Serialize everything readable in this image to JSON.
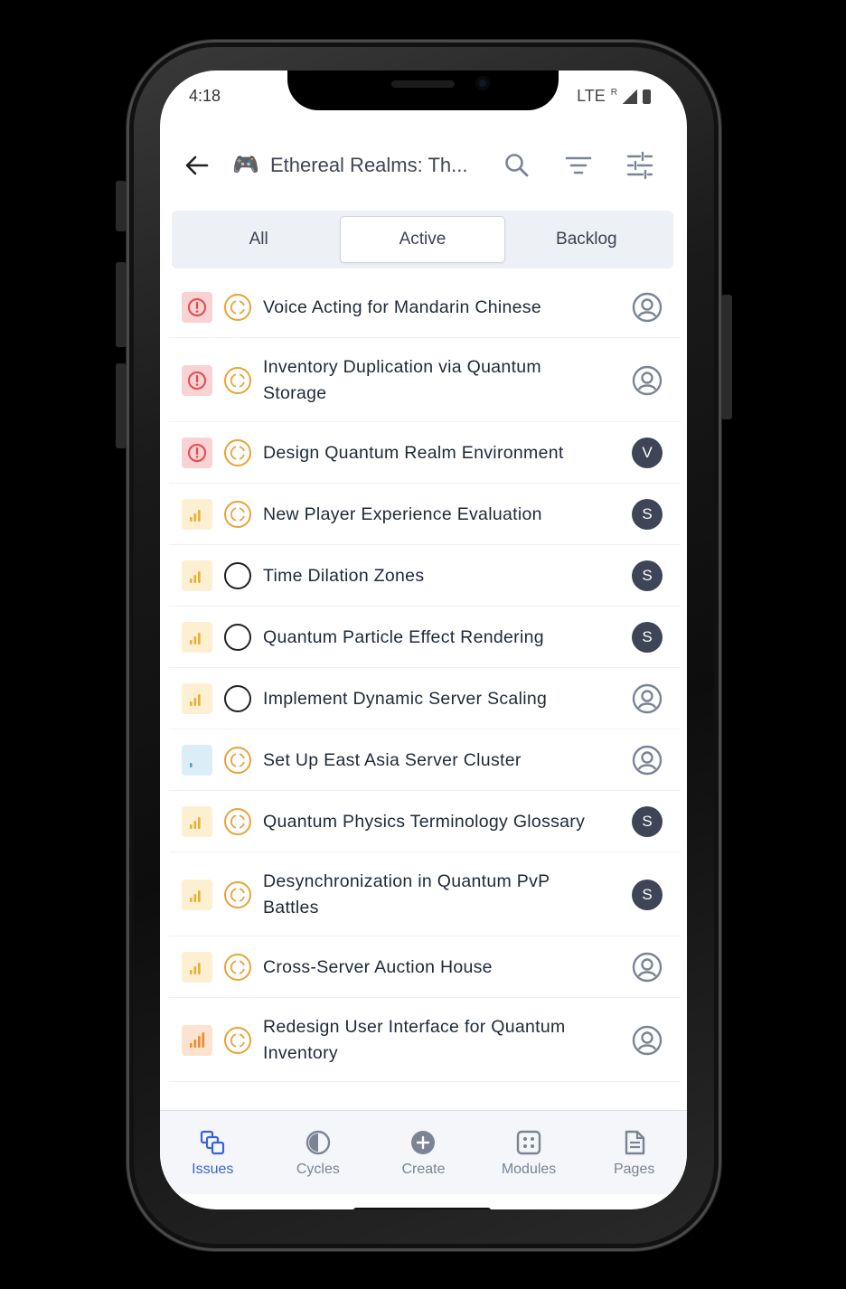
{
  "status_bar": {
    "time": "4:18",
    "network": "LTE",
    "roaming": "R"
  },
  "header": {
    "project_emoji": "🎮",
    "project_title": "Ethereal Realms: Th...",
    "icons": [
      "arrow-left-icon",
      "search-icon",
      "filter-icon",
      "sliders-icon"
    ]
  },
  "tabs": [
    {
      "label": "All",
      "active": false
    },
    {
      "label": "Active",
      "active": true
    },
    {
      "label": "Backlog",
      "active": false
    }
  ],
  "issues": [
    {
      "title_lines": [
        "Voice Acting for Mandarin Chinese"
      ],
      "priority": "urgent",
      "state": "in-progress",
      "assignee": ""
    },
    {
      "title_lines": [
        "Inventory Duplication via Quantum",
        "Storage"
      ],
      "priority": "urgent",
      "state": "in-progress",
      "assignee": ""
    },
    {
      "title_lines": [
        "Design Quantum Realm Environment"
      ],
      "priority": "urgent",
      "state": "in-progress",
      "assignee": "V"
    },
    {
      "title_lines": [
        "New Player Experience Evaluation"
      ],
      "priority": "medium",
      "state": "in-progress",
      "assignee": "S"
    },
    {
      "title_lines": [
        "Time Dilation Zones"
      ],
      "priority": "medium",
      "state": "todo",
      "assignee": "S"
    },
    {
      "title_lines": [
        "Quantum Particle Effect Rendering"
      ],
      "priority": "medium",
      "state": "todo",
      "assignee": "S"
    },
    {
      "title_lines": [
        "Implement Dynamic Server Scaling"
      ],
      "priority": "medium",
      "state": "todo",
      "assignee": ""
    },
    {
      "title_lines": [
        "Set Up East Asia Server Cluster"
      ],
      "priority": "low",
      "state": "in-progress",
      "assignee": ""
    },
    {
      "title_lines": [
        "Quantum Physics Terminology Glossary"
      ],
      "priority": "medium",
      "state": "in-progress",
      "assignee": "S"
    },
    {
      "title_lines": [
        "Desynchronization in Quantum PvP",
        "Battles"
      ],
      "priority": "medium",
      "state": "in-progress",
      "assignee": "S"
    },
    {
      "title_lines": [
        "Cross-Server Auction House"
      ],
      "priority": "medium",
      "state": "in-progress",
      "assignee": ""
    },
    {
      "title_lines": [
        "Redesign User Interface for Quantum",
        "Inventory"
      ],
      "priority": "high",
      "state": "in-progress",
      "assignee": ""
    }
  ],
  "bottom_nav": [
    {
      "label": "Issues",
      "icon": "layers-icon",
      "active": true
    },
    {
      "label": "Cycles",
      "icon": "contrast-icon",
      "active": false
    },
    {
      "label": "Create",
      "icon": "plus-circle-icon",
      "active": false
    },
    {
      "label": "Modules",
      "icon": "grid-dots-icon",
      "active": false
    },
    {
      "label": "Pages",
      "icon": "document-icon",
      "active": false
    }
  ],
  "colors": {
    "accent": "#3b63d9",
    "urgent": "#e5484d",
    "medium": "#e8b02f",
    "low": "#3fa7d6",
    "high": "#f0882d",
    "in_progress": "#e8a33a"
  }
}
